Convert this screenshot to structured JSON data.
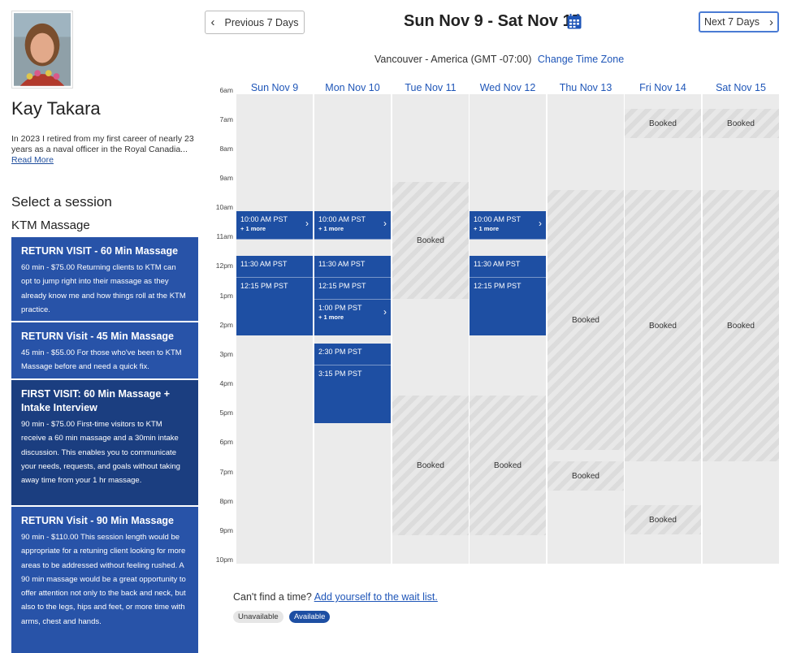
{
  "provider": {
    "name": "Kay Takara",
    "bio": "In 2023 I retired from my first career of nearly 23 years as a naval officer in the Royal Canadia...",
    "read_more": "Read More"
  },
  "session": {
    "heading": "Select a session",
    "category": "KTM Massage",
    "cards": [
      {
        "title": "RETURN VISIT - 60 Min Massage",
        "desc": "60 min - $75.00 Returning clients to KTM can opt to jump right into their massage as they already know me and how things roll at the KTM practice."
      },
      {
        "title": "RETURN Visit - 45 Min Massage",
        "desc": "45 min - $55.00 For those who've been to KTM Massage before and need a quick fix."
      },
      {
        "title": "FIRST VISIT: 60 Min Massage + Intake Interview",
        "desc": "90 min - $75.00 First-time visitors to KTM receive a 60 min massage and a 30min intake discussion. This enables you to communicate your needs, requests, and goals without taking away time from your 1 hr massage."
      },
      {
        "title": "RETURN Visit - 90 Min Massage",
        "desc": "90 min - $110.00 This session length would be appropriate for a retuning client looking for more areas to be addressed without feeling rushed. A 90 min massage would be a great opportunity to offer attention not only to the back and neck, but also to the legs, hips and feet, or more time with arms, chest and hands."
      }
    ]
  },
  "nav": {
    "prev": "Previous 7 Days",
    "next": "Next 7 Days",
    "range": "Sun Nov 9 - Sat Nov 15",
    "calendar_icon": "calendar-icon",
    "chevron_left": "‹",
    "chevron_right": "›"
  },
  "timezone": {
    "label": "Vancouver - America (GMT -07:00)",
    "change": "Change Time Zone"
  },
  "days": [
    "Sun Nov 9",
    "Mon Nov 10",
    "Tue Nov 11",
    "Wed Nov 12",
    "Thu Nov 13",
    "Fri Nov 14",
    "Sat Nov 15"
  ],
  "hours": [
    "6am",
    "7am",
    "8am",
    "9am",
    "10am",
    "11am",
    "12pm",
    "1pm",
    "2pm",
    "3pm",
    "4pm",
    "5pm",
    "6pm",
    "7pm",
    "8pm",
    "9pm",
    "10pm"
  ],
  "booked_label": "Booked",
  "slots": {
    "t1000": "10:00 AM PST",
    "t1130": "11:30 AM PST",
    "t1215": "12:15 PM PST",
    "t1300": "1:00 PM PST",
    "t1430": "2:30 PM PST",
    "t1515": "3:15 PM PST",
    "more": "+ 1 more"
  },
  "footer": {
    "text": "Can't find a time?",
    "link": "Add yourself to the wait list."
  },
  "legend": {
    "unavailable": "Unavailable",
    "available": "Available"
  },
  "colors": {
    "accent": "#1e4fa3",
    "link": "#1f56b8",
    "card": "#2853a8",
    "card_selected": "#1b3e80"
  }
}
